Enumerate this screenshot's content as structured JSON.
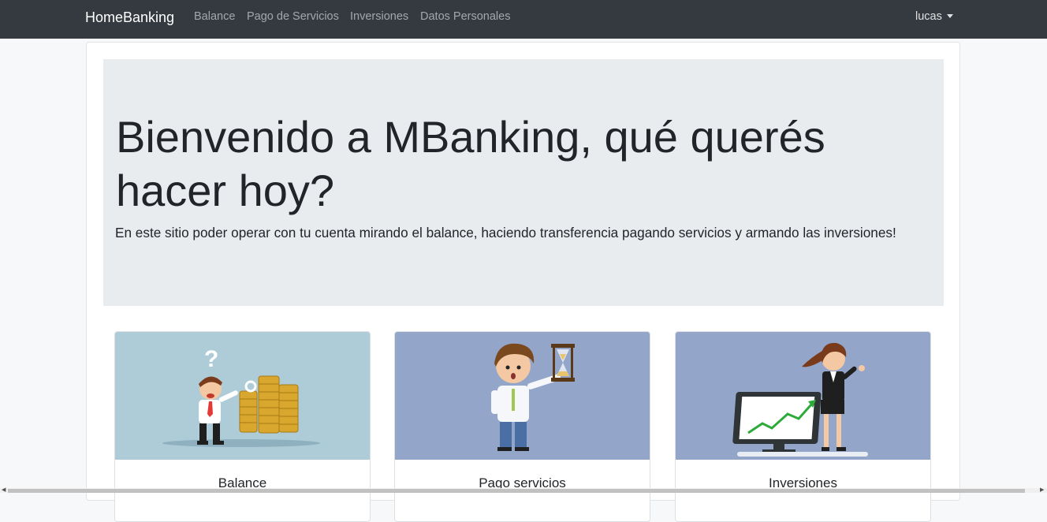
{
  "navbar": {
    "brand": "HomeBanking",
    "links": [
      {
        "label": "Balance"
      },
      {
        "label": "Pago de Servicios"
      },
      {
        "label": "Inversiones"
      },
      {
        "label": "Datos Personales"
      }
    ],
    "user": "lucas"
  },
  "jumbotron": {
    "title": "Bienvenido a MBanking, qué querés hacer hoy?",
    "lead": "En este sitio poder operar con tu cuenta mirando el balance, haciendo transferencia pagando servicios y armando las inversiones!"
  },
  "cards": [
    {
      "title": "Balance",
      "image_bg": "#aecbd8",
      "icon": "confused-man-coins-illustration"
    },
    {
      "title": "Pago servicios",
      "image_bg": "#93a5c9",
      "icon": "man-hourglass-illustration"
    },
    {
      "title": "Inversiones",
      "image_bg": "#93a5c9",
      "icon": "woman-growth-chart-illustration"
    }
  ],
  "colors": {
    "navbar_bg": "#343a40",
    "jumbotron_bg": "#e9ecef",
    "page_bg": "#f7f8f9"
  }
}
